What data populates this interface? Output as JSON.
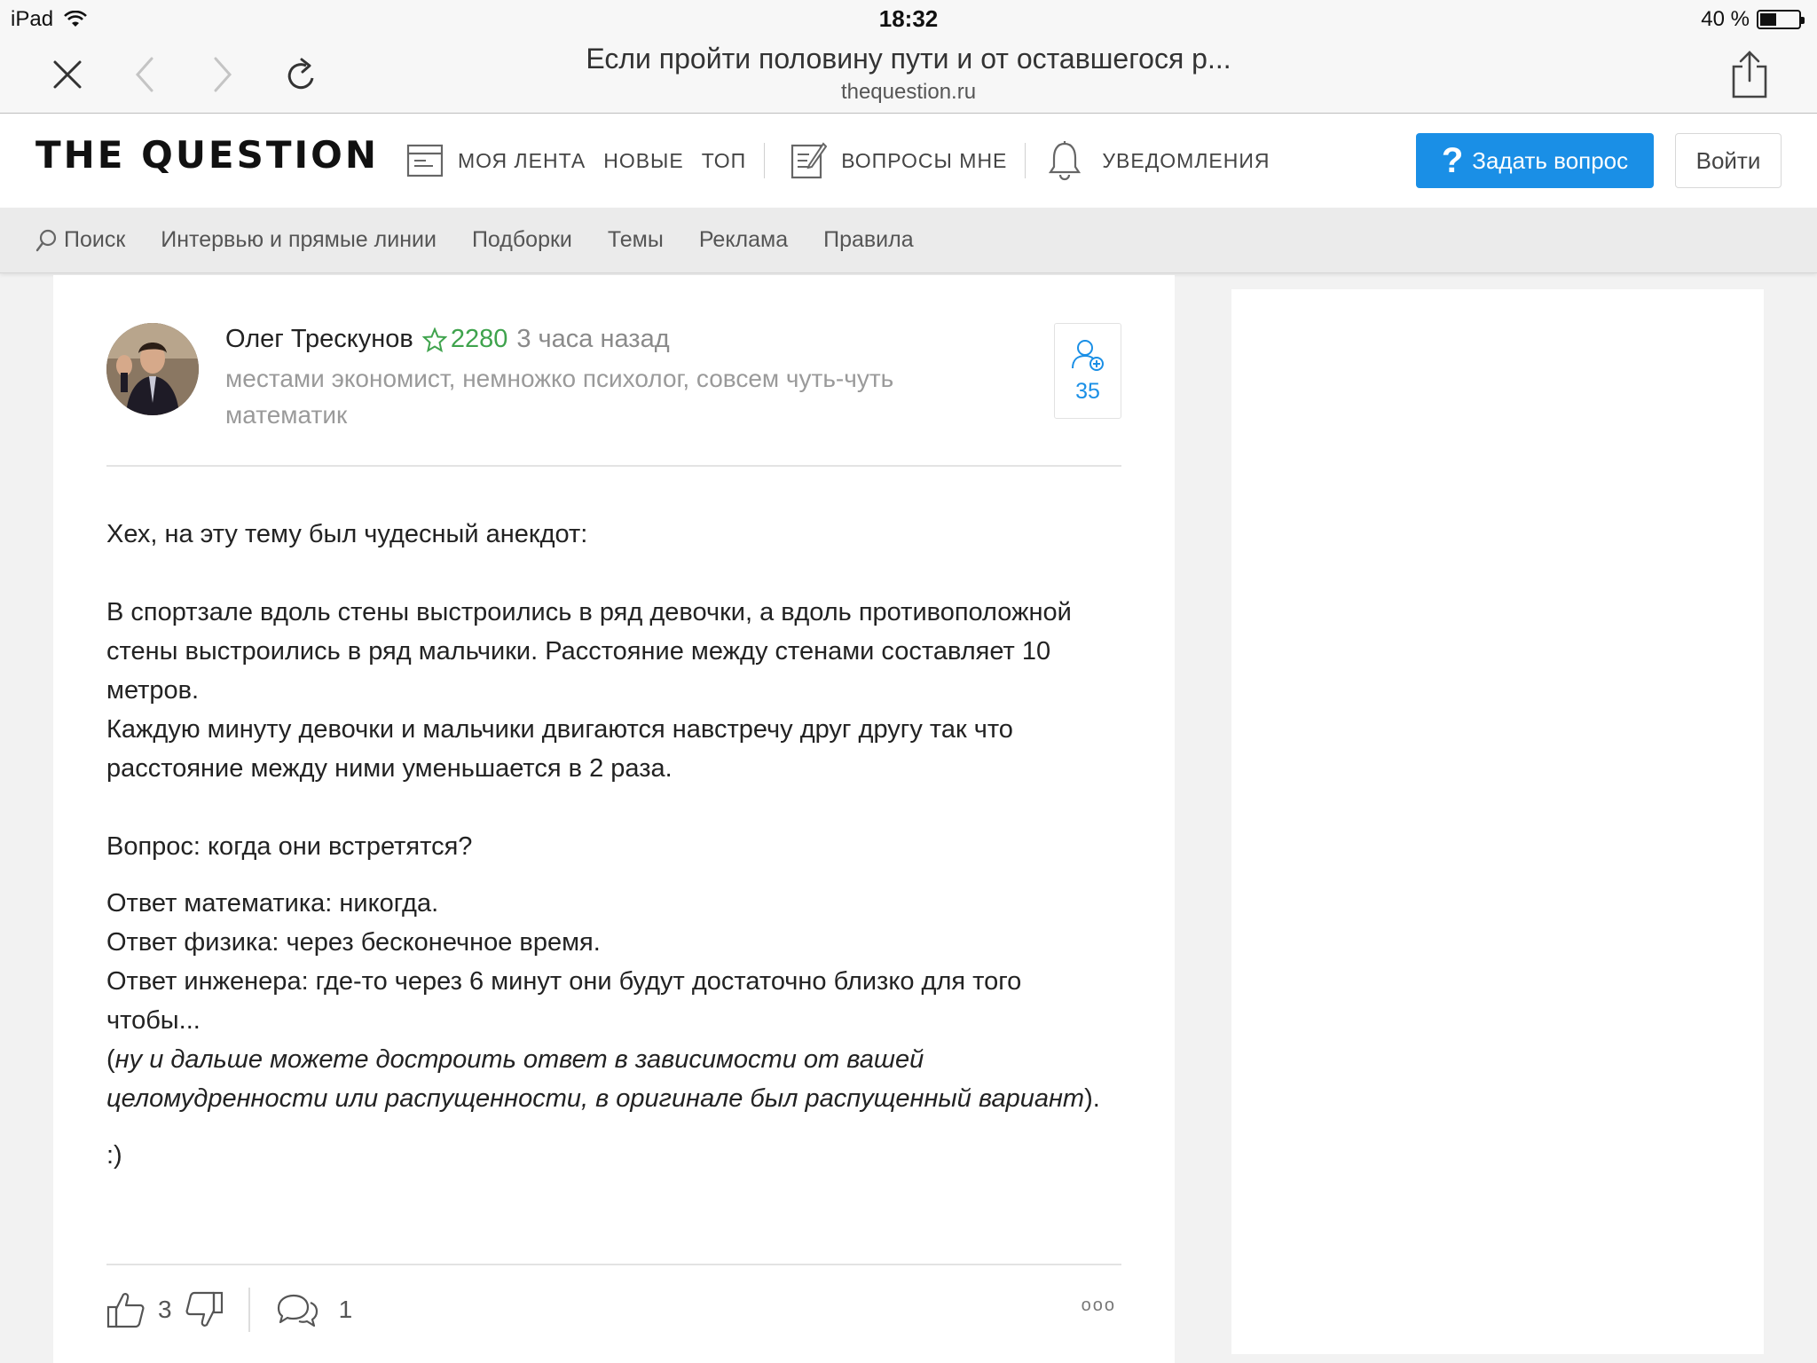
{
  "status_bar": {
    "device": "iPad",
    "time": "18:32",
    "battery": "40 %",
    "battery_level": 0.4
  },
  "browser": {
    "page_title": "Если пройти половину пути и от оставшегося р...",
    "url": "thequestion.ru"
  },
  "site_header": {
    "logo": "THE QUESTION",
    "nav": {
      "my_feed": "МОЯ ЛЕНТА",
      "new": "НОВЫЕ",
      "top": "ТОП",
      "questions_to_me": "ВОПРОСЫ МНЕ",
      "notifications": "УВЕДОМЛЕНИЯ"
    },
    "ask_button": "Задать вопрос",
    "login_button": "Войти",
    "accent_color": "#1a8fe6"
  },
  "subnav": {
    "search": "Поиск",
    "items": [
      "Интервью и прямые линии",
      "Подборки",
      "Темы",
      "Реклама",
      "Правила"
    ]
  },
  "answer": {
    "author": {
      "name": "Олег Трескунов",
      "rating": "2280",
      "time_ago": "3 часа назад",
      "description": "местами экономист, немножко психолог, совсем чуть-чуть математик"
    },
    "followers": "35",
    "paragraphs": {
      "p1": "Хех, на эту тему был чудесный анекдот:",
      "p2": "В спортзале вдоль стены выстроились в ряд девочки, а вдоль противоположной стены выстроились в ряд мальчики. Расстояние между стенами составляет 10 метров.",
      "p3": "Каждую минуту девочки и мальчики двигаются навстречу друг другу так что расстояние между ними уменьшается в 2 раза.",
      "p4": "Вопрос: когда они встретятся?",
      "p5": "Ответ математика: никогда.",
      "p6": "Ответ физика: через бесконечное время.",
      "p7": "Ответ инженера: где-то через 6 минут они будут достаточно близко для того чтобы...",
      "p8_open": "(",
      "p8_italic": "ну и дальше можете достроить ответ в зависимости от вашей целомудренности или распущенности, в оригинале был распущенный вариант",
      "p8_close": ").",
      "p9": ":)"
    },
    "actions": {
      "likes": "3",
      "comments": "1",
      "more": "ooo"
    }
  }
}
